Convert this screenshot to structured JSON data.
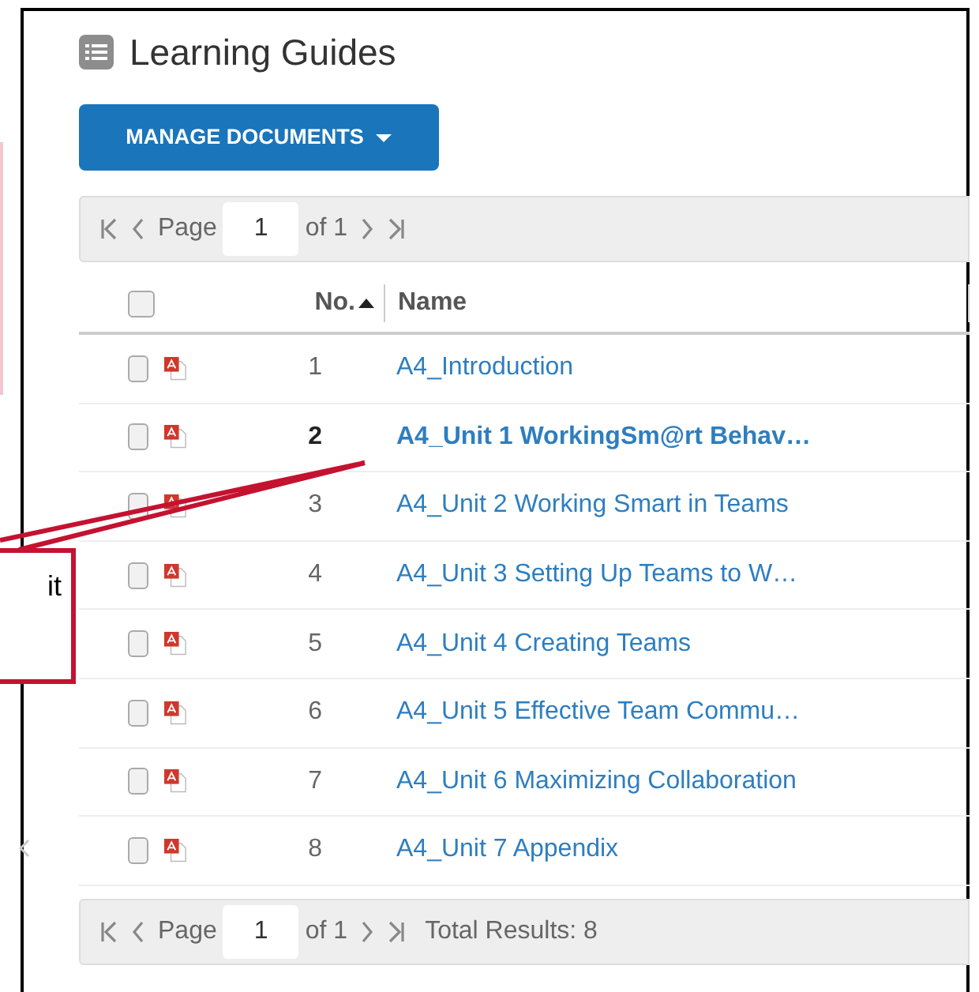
{
  "panel": {
    "title": "Learning Guides"
  },
  "manage_button": {
    "label": "MANAGE DOCUMENTS"
  },
  "pager_top": {
    "page_label": "Page",
    "page_value": "1",
    "of_label": "of 1"
  },
  "table": {
    "select_all": {
      "checked": false
    },
    "columns": [
      {
        "label": "No.",
        "sorted": true
      },
      {
        "label": "Name",
        "sorted": false
      }
    ],
    "rows": [
      {
        "checked": false,
        "kind": "pdf",
        "number": "1",
        "name": "A4_Introduction",
        "bold": false
      },
      {
        "checked": false,
        "kind": "pdf",
        "number": "2",
        "name": "A4_Unit 1 WorkingSm@rt Behav…",
        "bold": true
      },
      {
        "checked": false,
        "kind": "pdf",
        "number": "3",
        "name": "A4_Unit 2 Working Smart in Teams",
        "bold": false
      },
      {
        "checked": false,
        "kind": "pdf",
        "number": "4",
        "name": "A4_Unit 3 Setting Up Teams to W…",
        "bold": false
      },
      {
        "checked": false,
        "kind": "pdf",
        "number": "5",
        "name": "A4_Unit 4 Creating Teams",
        "bold": false
      },
      {
        "checked": false,
        "kind": "pdf",
        "number": "6",
        "name": "A4_Unit 5 Effective Team Commu…",
        "bold": false
      },
      {
        "checked": false,
        "kind": "pdf",
        "number": "7",
        "name": "A4_Unit 6 Maximizing Collaboration",
        "bold": false
      },
      {
        "checked": false,
        "kind": "pdf",
        "number": "8",
        "name": "A4_Unit 7 Appendix",
        "bold": false
      }
    ]
  },
  "pager_bottom": {
    "page_label": "Page",
    "page_value": "1",
    "of_label": "of 1",
    "total": "Total Results: 8"
  },
  "callout": {
    "text": "it"
  }
}
